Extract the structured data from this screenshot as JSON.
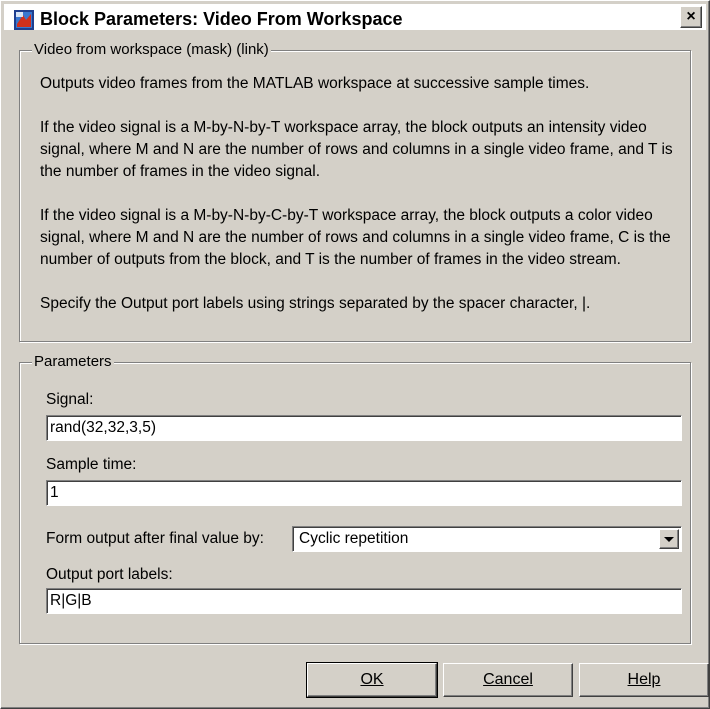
{
  "window": {
    "title": "Block Parameters: Video From Workspace",
    "close_glyph": "×"
  },
  "mask_group": {
    "legend": "Video from workspace (mask) (link)",
    "paragraphs": [
      "Outputs video frames from the MATLAB workspace at successive sample times.",
      "If the video signal is a M-by-N-by-T workspace array, the block outputs an intensity video signal, where M and N are the number of rows and columns in a single video frame, and T is the number of frames in the video signal.",
      "If the video signal is a M-by-N-by-C-by-T workspace array, the block outputs a color video signal, where M and N are the number of rows and columns in a single video frame, C is the number of outputs from the block, and T is the number of frames in the video stream.",
      "Specify the Output port labels using strings separated by the spacer character, |."
    ]
  },
  "params_group": {
    "legend": "Parameters",
    "signal_label": "Signal:",
    "signal_value": "rand(32,32,3,5)",
    "sample_time_label": "Sample time:",
    "sample_time_value": "1",
    "form_output_label": "Form output after final value by:",
    "form_output_value": "Cyclic repetition",
    "output_port_label": "Output port labels:",
    "output_port_value": "R|G|B"
  },
  "buttons": {
    "ok": "OK",
    "cancel": "Cancel",
    "help": "Help"
  },
  "colors": {
    "dialog_bg": "#d4d0c8",
    "titlebar_bg": "#ffffff"
  }
}
